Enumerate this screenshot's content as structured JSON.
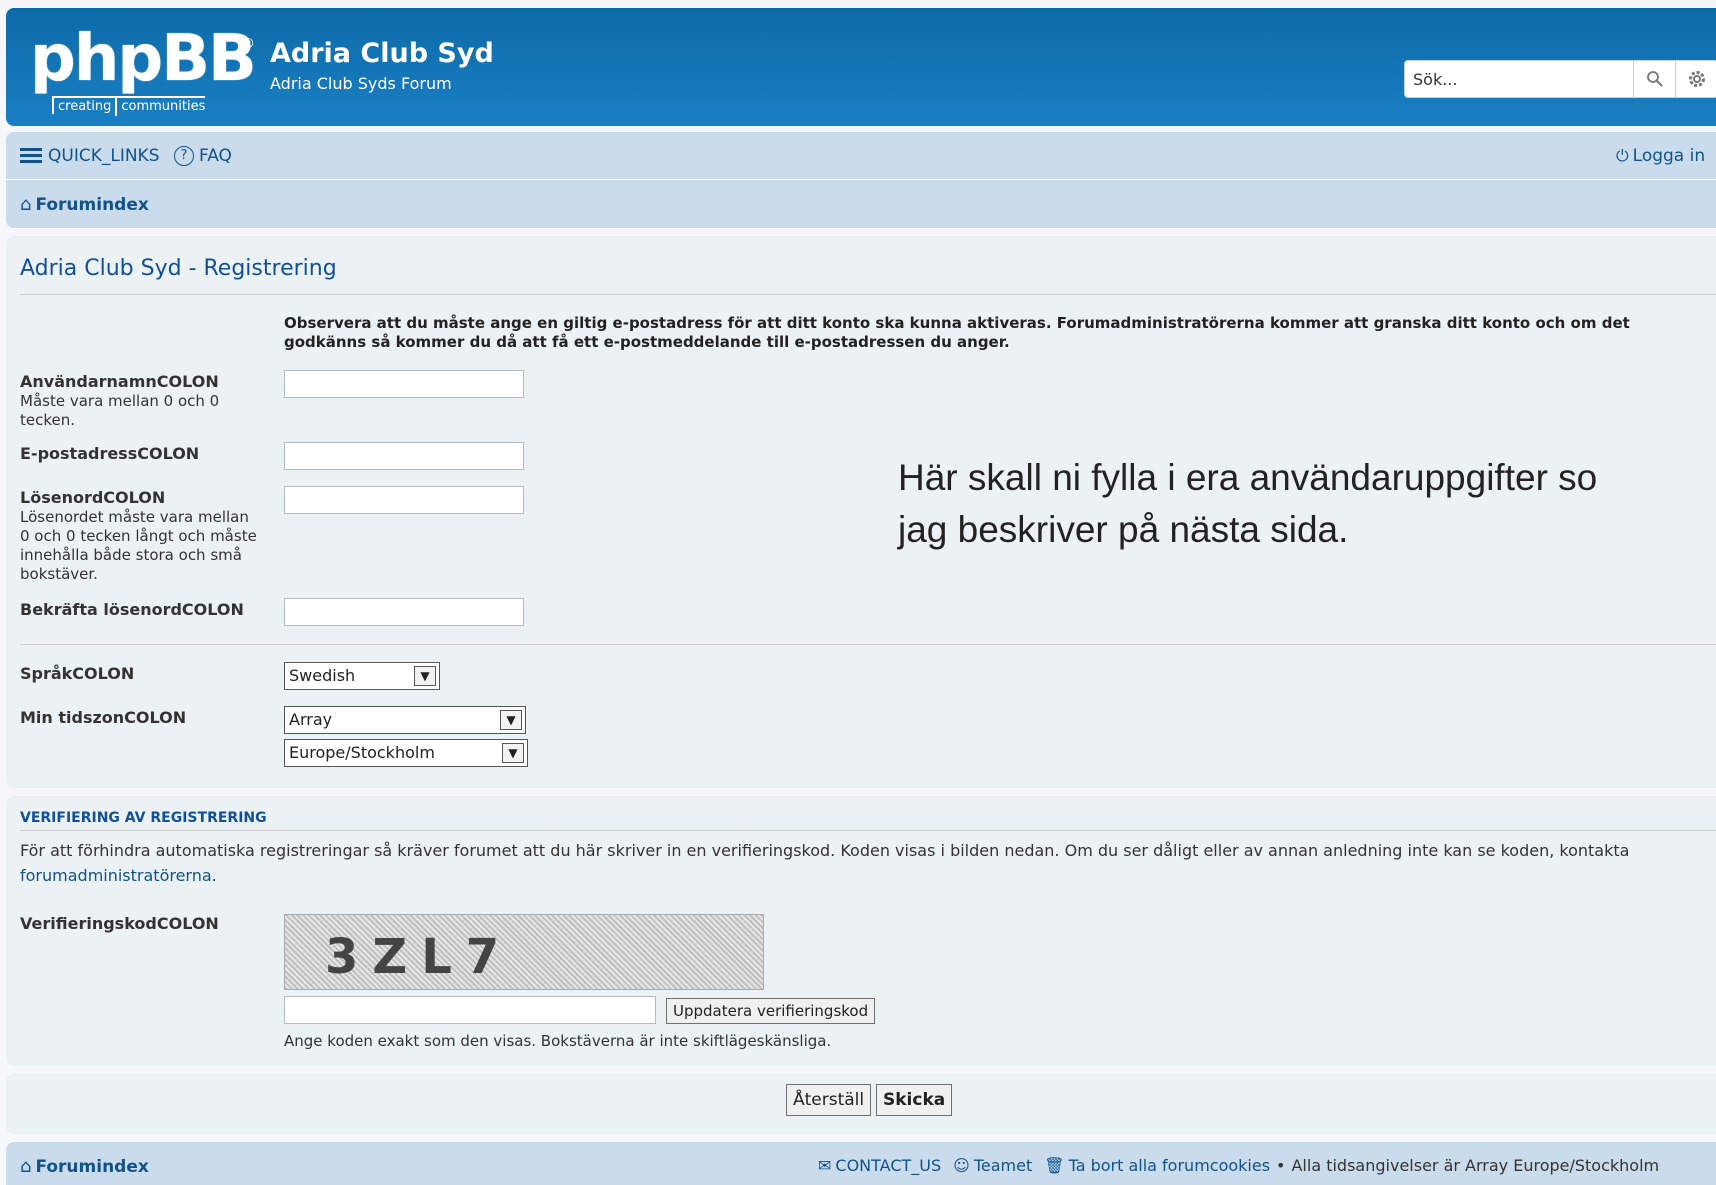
{
  "header": {
    "logo_text": "phpBB",
    "logo_reg": "®",
    "logo_tag_1": "creating",
    "logo_tag_2": "communities",
    "site_title": "Adria Club Syd",
    "site_desc": "Adria Club Syds Forum",
    "search_placeholder": "Sök..."
  },
  "nav": {
    "quick_links": "QUICK_LINKS",
    "faq": "FAQ",
    "login": "Logga in",
    "breadcrumb_home": "Forumindex"
  },
  "form": {
    "title": "Adria Club Syd - Registrering",
    "notice": "Observera att du måste ange en giltig e-postadress för att ditt konto ska kunna aktiveras. Forumadministratörerna kommer att granska ditt konto och om det godkänns så kommer du då att få ett e-postmeddelande till e-postadressen du anger.",
    "username_label": "AnvändarnamnCOLON",
    "username_explain": "Måste vara mellan 0 och 0 tecken.",
    "email_label": "E-postadressCOLON",
    "password_label": "LösenordCOLON",
    "password_explain": "Lösenordet måste vara mellan 0 och 0 tecken långt och måste innehålla både stora och små bokstäver.",
    "confirm_label": "Bekräfta lösenordCOLON",
    "language_label": "SpråkCOLON",
    "language_value": "Swedish",
    "timezone_label": "Min tidszonCOLON",
    "timezone_value_1": "Array",
    "timezone_value_2": "Europe/Stockholm"
  },
  "overlay_note": {
    "line1": "Här skall ni fylla i era användaruppgifter so",
    "line2": "jag beskriver på nästa sida."
  },
  "verification": {
    "heading": "VERIFIERING AV REGISTRERING",
    "text_before": "För att förhindra automatiska registreringar så kräver forumet att du här skriver in en verifieringskod. Koden visas i bilden nedan. Om du ser dåligt eller av annan anledning inte kan se koden, kontakta ",
    "link": "forumadministratörerna",
    "text_after": ".",
    "code_label": "VerifieringskodCOLON",
    "captcha_text": "3ZL7",
    "refresh_button": "Uppdatera verifieringskod",
    "explain": "Ange koden exakt som den visas. Bokstäverna är inte skiftlägeskänsliga."
  },
  "buttons": {
    "reset": "Återställ",
    "submit": "Skicka"
  },
  "footer": {
    "home": "Forumindex",
    "contact": "CONTACT_US",
    "team": "Teamet",
    "delete_cookies": "Ta bort alla forumcookies",
    "bullet": "•",
    "timezone_note": "Alla tidsangivelser är Array Europe/Stockholm"
  }
}
